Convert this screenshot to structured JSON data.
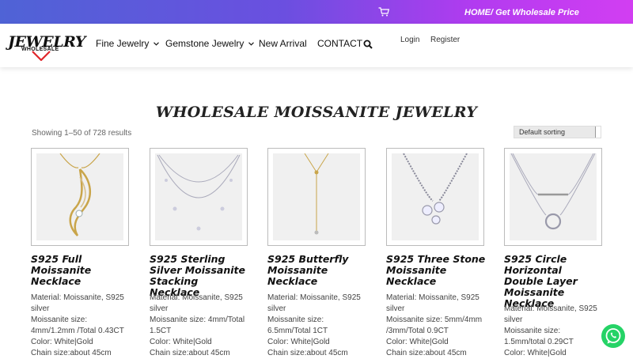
{
  "topbar": {
    "cart_icon": "cart-icon",
    "link": "HOME/ Get Wholesale Price",
    "gradient": [
      "#4f63d6",
      "#b23bf0",
      "#d23ef2"
    ]
  },
  "header": {
    "logo": {
      "main": "JEWELRY",
      "sub": "WHOLESALE"
    },
    "nav": [
      {
        "label": "Fine Jewelry",
        "dropdown": true
      },
      {
        "label": "Gemstone Jewelry",
        "dropdown": true
      },
      {
        "label": "New Arrival",
        "dropdown": false
      },
      {
        "label": "CONTACT",
        "dropdown": false
      }
    ],
    "login": "Login",
    "register": "Register"
  },
  "main": {
    "title": "WHOLESALE MOISSANITE JEWELRY",
    "results": "Showing 1–50 of 728 results",
    "sort": "Default sorting",
    "products": [
      {
        "name": "S925 Full Moissanite Necklace",
        "desc": [
          "Material: Moissanite, S925 silver",
          "Moissanite size: 4mm/1.2mm /Total 0.43CT",
          "Color: White|Gold",
          "Chain size:about 45cm"
        ]
      },
      {
        "name": "S925 Sterling Silver Moissanite Stacking Necklace",
        "desc": [
          "Material: Moissanite, S925 silver",
          "Moissanite size: 4mm/Total 1.5CT",
          "Color: White|Gold",
          "Chain size:about 45cm"
        ]
      },
      {
        "name": "S925 Butterfly Moissanite Necklace",
        "desc": [
          "Material: Moissanite, S925 silver",
          "Moissanite size: 6.5mm/Total 1CT",
          "Color: White|Gold",
          "Chain size:about 45cm"
        ]
      },
      {
        "name": "S925 Three Stone Moissanite Necklace",
        "desc": [
          "Material: Moissanite, S925 silver",
          "Moissanite size: 5mm/4mm /3mm/Total 0.9CT",
          "Color: White|Gold",
          "Chain size:about 45cm"
        ]
      },
      {
        "name": "S925 Circle Horizontal Double Layer Moissanite Necklace",
        "desc": [
          "Material: Moissanite, S925 silver",
          "Moissanite size: 1.5mm/total 0.29CT",
          "Color: White|Gold"
        ]
      }
    ]
  },
  "whatsapp_icon": "whatsapp-icon",
  "colors": {
    "whatsapp": "#25d366",
    "text": "#222222",
    "logo_arrow": "#e0262b"
  }
}
